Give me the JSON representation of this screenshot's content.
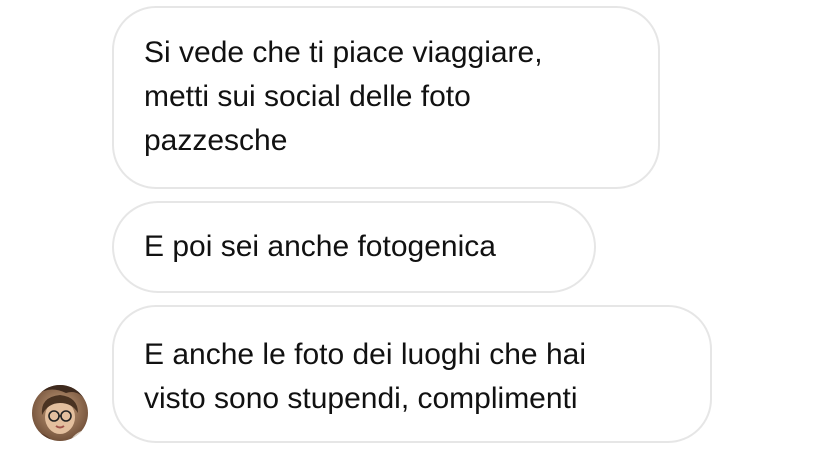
{
  "messages": [
    {
      "lines": [
        "Si vede che ti piace viaggiare,",
        "metti sui social delle foto",
        "pazzesche"
      ]
    },
    {
      "lines": [
        "E poi sei anche fotogenica"
      ]
    },
    {
      "lines": [
        "E anche le foto dei luoghi che hai",
        "visto sono stupendi, complimenti"
      ]
    }
  ],
  "sender": {
    "avatar": "profile-photo-thumbnail"
  },
  "colors": {
    "bubble_border": "#e6e6e6",
    "text": "#111111",
    "background": "#ffffff"
  }
}
